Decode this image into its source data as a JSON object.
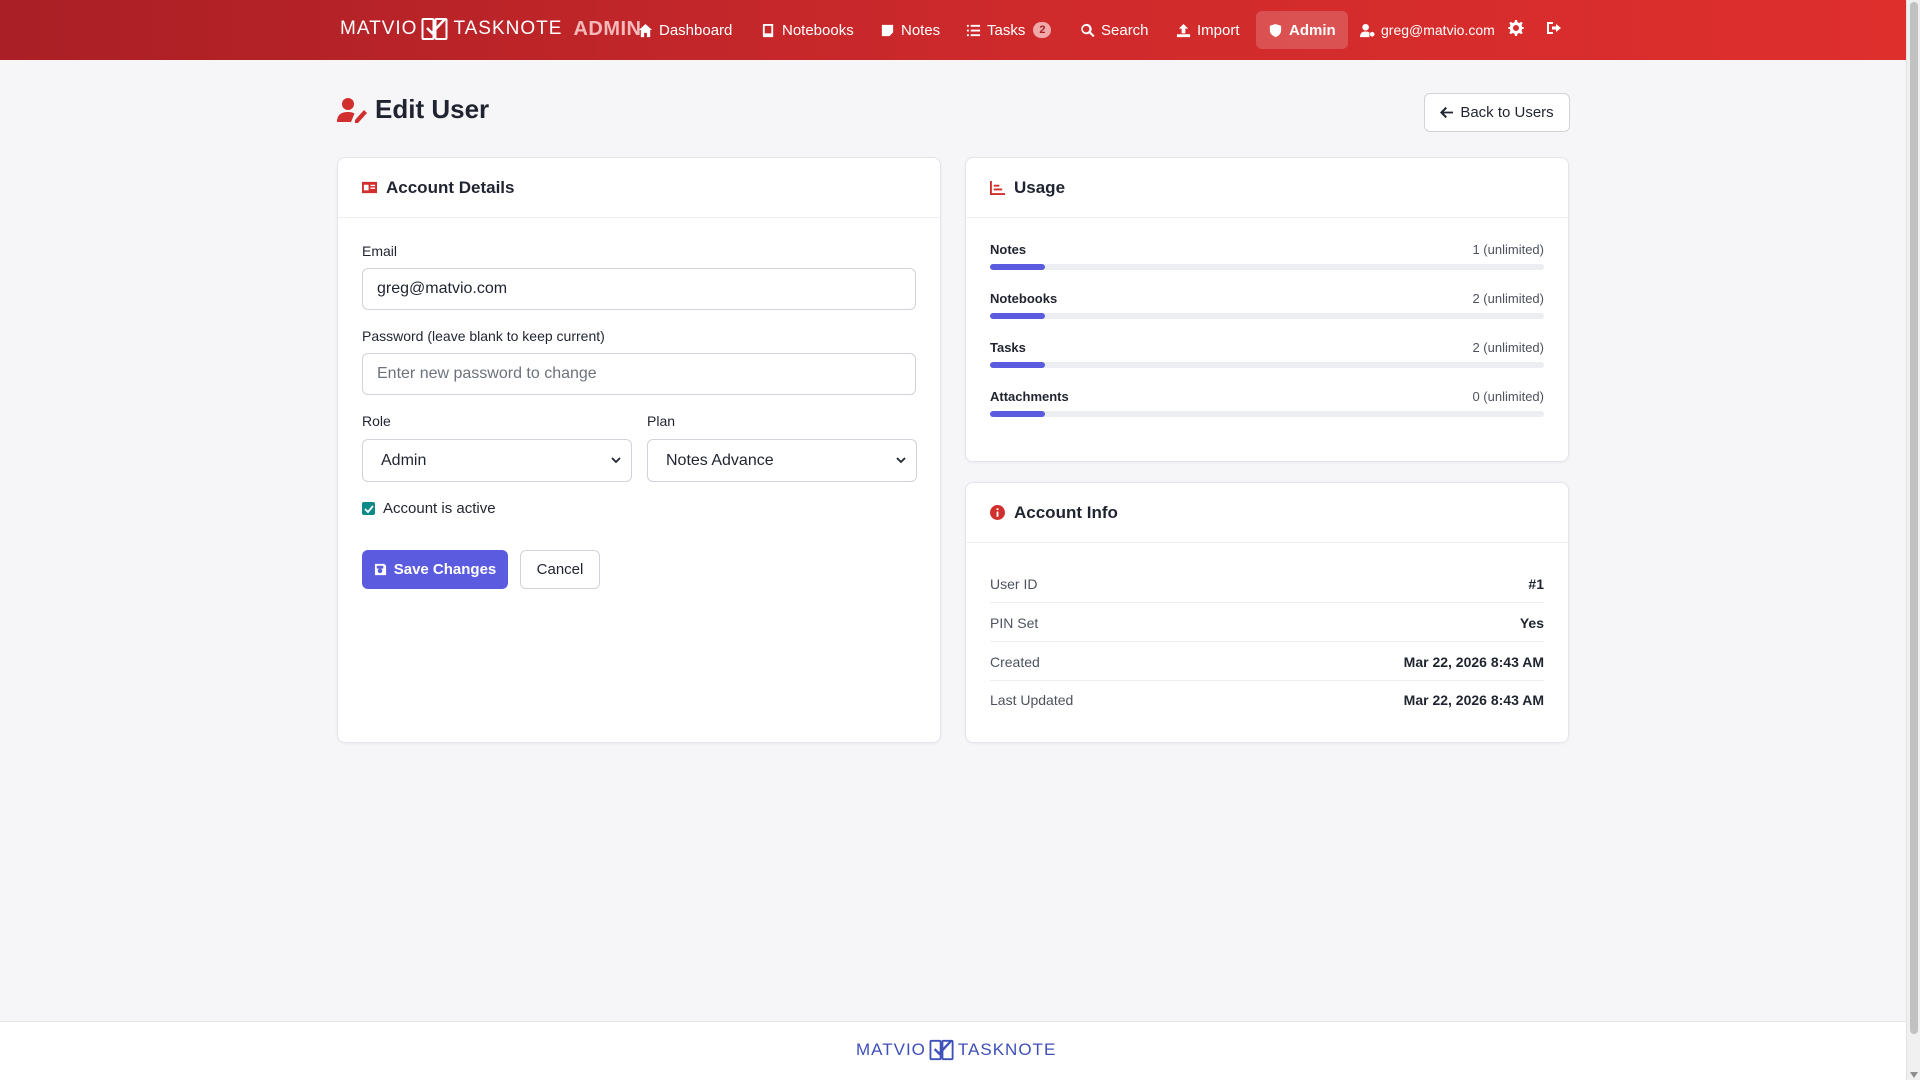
{
  "brand": {
    "left": "MATVIO",
    "right": "TASKNOTE",
    "admin": "ADMIN"
  },
  "nav": {
    "items": [
      {
        "label": "Dashboard",
        "icon": "home-icon"
      },
      {
        "label": "Notebooks",
        "icon": "book-icon"
      },
      {
        "label": "Notes",
        "icon": "note-icon"
      },
      {
        "label": "Tasks",
        "icon": "list-icon",
        "badge": "2"
      },
      {
        "label": "Search",
        "icon": "search-icon"
      },
      {
        "label": "Import",
        "icon": "upload-icon"
      },
      {
        "label": "Admin",
        "icon": "shield-icon",
        "active": true
      }
    ],
    "user_email": "greg@matvio.com"
  },
  "page": {
    "title": "Edit User",
    "back_label": "Back to Users"
  },
  "account_details": {
    "title": "Account Details",
    "email_label": "Email",
    "email_value": "greg@matvio.com",
    "password_label": "Password (leave blank to keep current)",
    "password_placeholder": "Enter new password to change",
    "role_label": "Role",
    "role_value": "Admin",
    "plan_label": "Plan",
    "plan_value": "Notes Advance",
    "active_label": "Account is active",
    "active_checked": true,
    "save_label": "Save Changes",
    "cancel_label": "Cancel"
  },
  "usage": {
    "title": "Usage",
    "rows": [
      {
        "name": "Notes",
        "value": "1 (unlimited)",
        "fill": 0.1
      },
      {
        "name": "Notebooks",
        "value": "2 (unlimited)",
        "fill": 0.1
      },
      {
        "name": "Tasks",
        "value": "2 (unlimited)",
        "fill": 0.1
      },
      {
        "name": "Attachments",
        "value": "0 (unlimited)",
        "fill": 0.1
      }
    ]
  },
  "account_info": {
    "title": "Account Info",
    "rows": [
      {
        "key": "User ID",
        "value": "#1"
      },
      {
        "key": "PIN Set",
        "value": "Yes"
      },
      {
        "key": "Created",
        "value": "Mar 22, 2026 8:43 AM"
      },
      {
        "key": "Last Updated",
        "value": "Mar 22, 2026 8:43 AM"
      }
    ]
  },
  "footer": {
    "left": "MATVIO",
    "right": "TASKNOTE"
  },
  "colors": {
    "brand_red": "#cf2a2c",
    "accent": "#5b5be0",
    "checkbox": "#0e8a8a"
  }
}
